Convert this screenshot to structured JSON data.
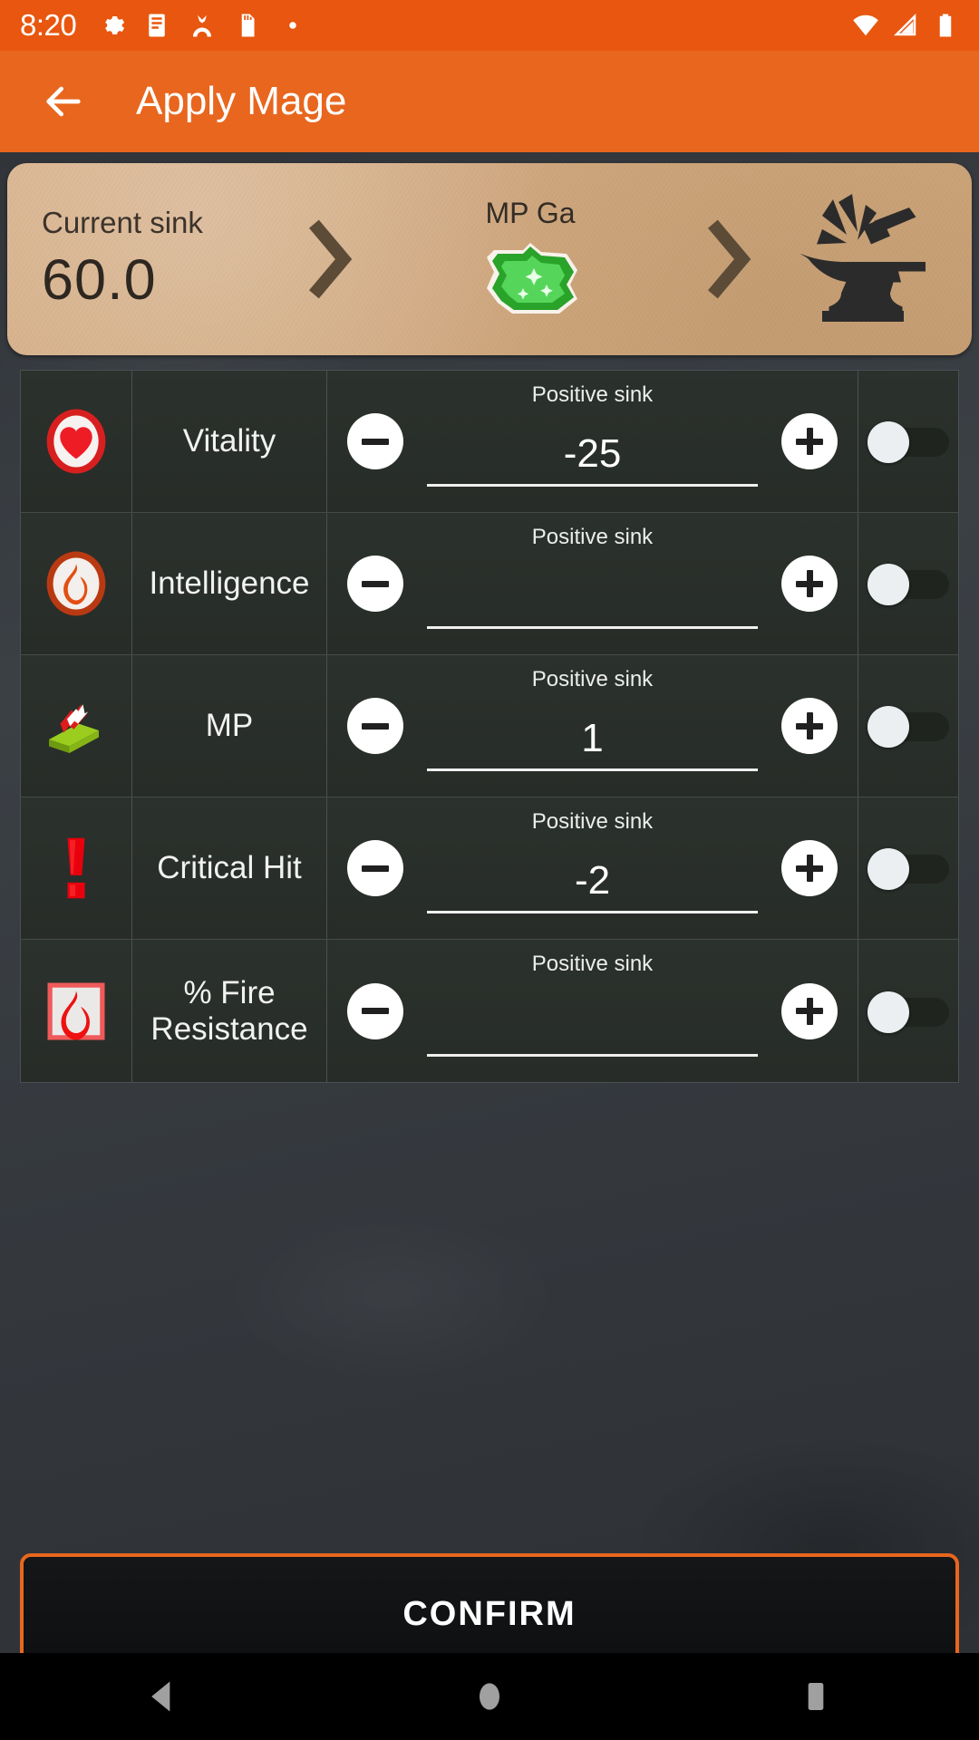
{
  "status_bar": {
    "time": "8:20",
    "left_icons": [
      "gear-icon",
      "document-icon",
      "avatar-icon",
      "sd-card-icon",
      "dot-icon"
    ],
    "right_icons": [
      "wifi-icon",
      "signal-icon",
      "battery-icon"
    ],
    "background_color": "#e8560f"
  },
  "app_bar": {
    "back_icon": "back-arrow-icon",
    "title": "Apply Mage",
    "background_color": "#e8661e"
  },
  "summary": {
    "sink_label": "Current sink",
    "sink_value": "60.0",
    "middle_label": "MP Ga",
    "middle_icon": "green-gem-icon",
    "chevron_icon": "chevron-right-icon",
    "result_icon": "anvil-hammer-icon"
  },
  "table": {
    "hint": "Positive sink",
    "minus_label": "−",
    "plus_label": "+",
    "rows": [
      {
        "icon": "heart-icon",
        "name": "Vitality",
        "value": "-25",
        "toggle": "off"
      },
      {
        "icon": "flame-circle-icon",
        "name": "Intelligence",
        "value": "",
        "toggle": "off"
      },
      {
        "icon": "green-bar-arrow-icon",
        "name": "MP",
        "value": "1",
        "toggle": "off"
      },
      {
        "icon": "exclamation-icon",
        "name": "Critical Hit",
        "value": "-2",
        "toggle": "off"
      },
      {
        "icon": "fire-resistance-icon",
        "name": "% Fire Resistance",
        "value": "",
        "toggle": "off"
      }
    ]
  },
  "confirm": {
    "label": "CONFIRM",
    "border_color": "#e8661e"
  },
  "nav_bar": {
    "back": "nav-back-icon",
    "home": "nav-home-icon",
    "recents": "nav-recents-icon"
  }
}
